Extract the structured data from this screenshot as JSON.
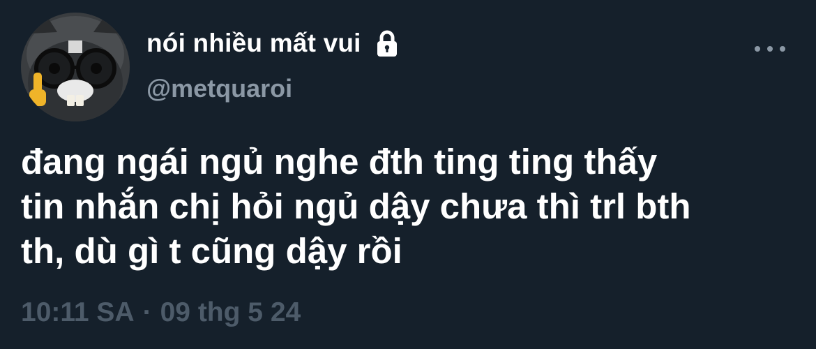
{
  "tweet": {
    "display_name": "nói nhiều mất vui",
    "handle": "@metquaroi",
    "text_lines": [
      "đang ngái ngủ nghe đth ting ting thấy",
      "tin nhắn chị hỏi ngủ dậy chưa thì trl bth",
      "th, dù gì t cũng dậy rồi"
    ],
    "time": "10:11 SA",
    "separator": "·",
    "date": "09 thg 5 24",
    "icons": {
      "avatar": "cat-with-glasses-avatar",
      "lock": "lock-icon",
      "more": "more-options-icon"
    }
  },
  "colors": {
    "background": "#15202b",
    "primary_text": "#ffffff",
    "secondary_text": "#8b98a5",
    "timestamp_text": "#4d5b69"
  }
}
